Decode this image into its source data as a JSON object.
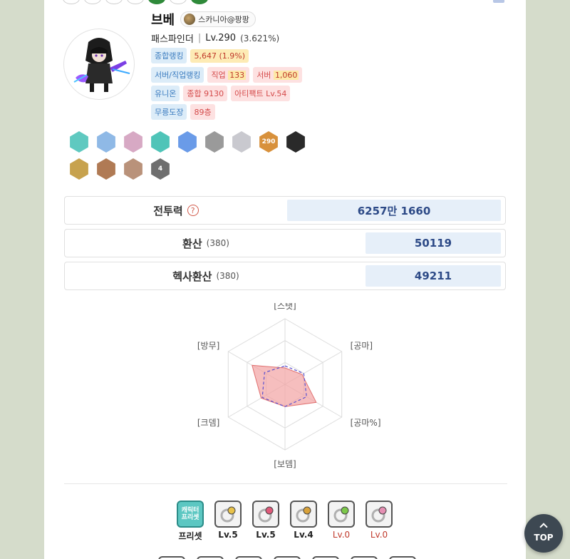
{
  "character": {
    "name": "브베",
    "server": "스카니아@팡팡",
    "job": "패스파인더",
    "level": "Lv.290",
    "exp_pct": "(3.621%)"
  },
  "rankings": {
    "overall_label": "종합랭킹",
    "overall_value": "5,647",
    "overall_pct": "(1.9%)",
    "server_job_label": "서버/직업랭킹",
    "job_label": "직업",
    "job_value": "133",
    "server_label": "서버",
    "server_value": "1,060",
    "union_label": "유니온",
    "union_total": "종합 9130",
    "artifact": "아티팩트 Lv.54",
    "dojang_label": "무릉도장",
    "dojang_value": "89층"
  },
  "badges": [
    {
      "icon": "medal-badge-icon",
      "color": "#5fc9c0",
      "text": ""
    },
    {
      "icon": "crown-badge-icon",
      "color": "#8fb9e6",
      "text": ""
    },
    {
      "icon": "target-badge-icon",
      "color": "#d7a9c4",
      "text": ""
    },
    {
      "icon": "heart-badge-icon",
      "color": "#4fc4b8",
      "text": ""
    },
    {
      "icon": "question-badge-icon",
      "color": "#6a9be8",
      "text": ""
    },
    {
      "icon": "gear-badge-icon",
      "color": "#9a9a9a",
      "text": ""
    },
    {
      "icon": "diamond-badge-icon",
      "color": "#c9c9cf",
      "text": ""
    },
    {
      "icon": "level-badge-icon",
      "color": "#d8913c",
      "text": "290"
    },
    {
      "icon": "demon-badge-icon",
      "color": "#2a2a2a",
      "text": ""
    },
    {
      "icon": "star-badge-icon",
      "color": "#c7a24e",
      "text": ""
    },
    {
      "icon": "slime-badge-icon",
      "color": "#b07a54",
      "text": ""
    },
    {
      "icon": "swords-badge-icon",
      "color": "#b9927a",
      "text": ""
    },
    {
      "icon": "rank-four-badge-icon",
      "color": "#6e6e6e",
      "text": "4"
    }
  ],
  "stats": {
    "combat_power_label": "전투력",
    "combat_power_value": "6257만 1660",
    "conversion_label": "환산",
    "conversion_sub": "(380)",
    "conversion_value": "50119",
    "hexa_label": "헥사환산",
    "hexa_sub": "(380)",
    "hexa_value": "49211"
  },
  "radar": {
    "labels": [
      "[스탯]",
      "[공마]",
      "[공마%]",
      "[보뎀]",
      "[크뎀]",
      "[방무]"
    ],
    "character_values": [
      0.25,
      0.3,
      0.55,
      0.34,
      0.42,
      0.58
    ],
    "average_values": [
      0.28,
      0.33,
      0.38,
      0.34,
      0.4,
      0.36
    ],
    "fill_color": "#f2a3a3",
    "average_color": "#5b4fcf"
  },
  "presets": [
    {
      "icon": "character-preset-icon",
      "label": "프리셋",
      "box_text": "캐릭터 프리셋",
      "red": false
    },
    {
      "icon": "ring-pink-gold-icon",
      "label": "Lv.5",
      "red": false
    },
    {
      "icon": "ring-pink-silver-icon",
      "label": "Lv.5",
      "red": false
    },
    {
      "icon": "ring-gold-gem-icon",
      "label": "Lv.4",
      "red": false
    },
    {
      "icon": "ring-green-icon",
      "label": "Lv.0",
      "red": true
    },
    {
      "icon": "ring-silver-pink-icon",
      "label": "Lv.0",
      "red": true
    }
  ],
  "top_button": "TOP"
}
